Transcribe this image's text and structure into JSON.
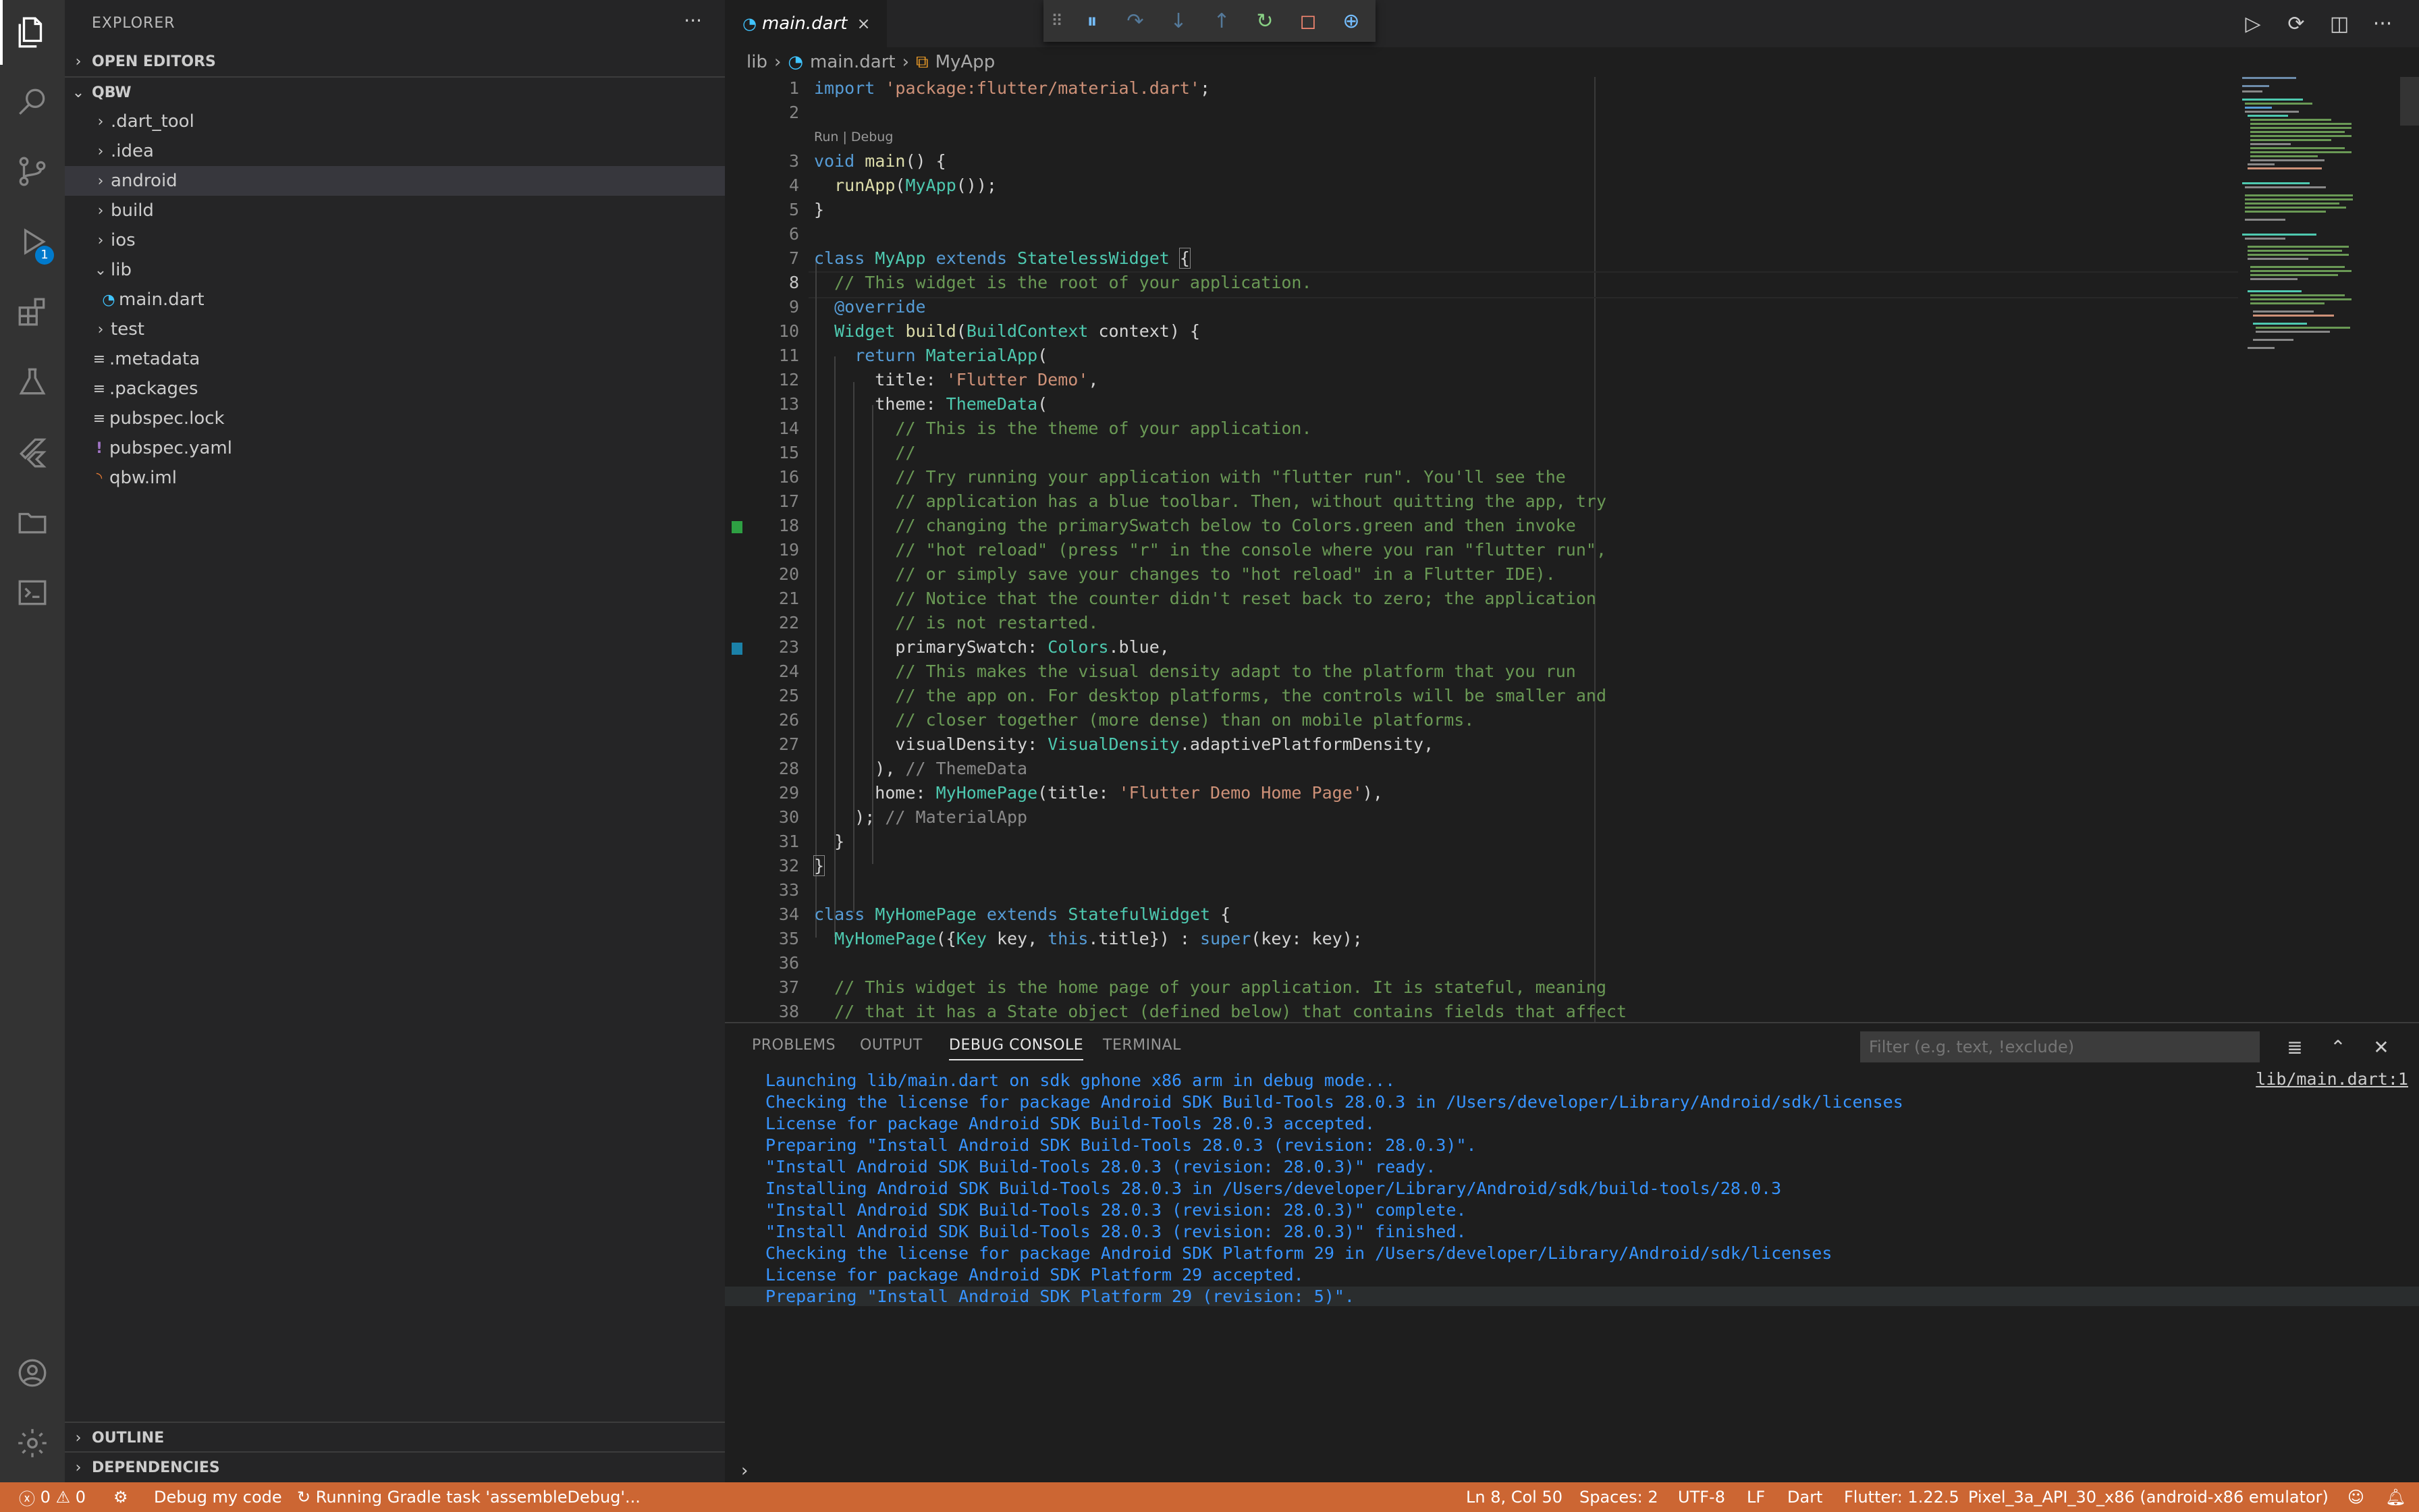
{
  "explorer": {
    "title": "EXPLORER",
    "more": "···",
    "open_editors": "OPEN EDITORS",
    "project": "QBW",
    "items": [
      {
        "label": ".dart_tool",
        "type": "folder"
      },
      {
        "label": ".idea",
        "type": "folder"
      },
      {
        "label": "android",
        "type": "folder"
      },
      {
        "label": "build",
        "type": "folder"
      },
      {
        "label": "ios",
        "type": "folder"
      },
      {
        "label": "lib",
        "type": "folder-open"
      },
      {
        "label": "main.dart",
        "type": "dart"
      },
      {
        "label": "test",
        "type": "folder"
      },
      {
        "label": ".metadata",
        "type": "text"
      },
      {
        "label": ".packages",
        "type": "text"
      },
      {
        "label": "pubspec.lock",
        "type": "text"
      },
      {
        "label": "pubspec.yaml",
        "type": "yaml"
      },
      {
        "label": "qbw.iml",
        "type": "rss"
      }
    ],
    "outline": "OUTLINE",
    "dependencies": "DEPENDENCIES"
  },
  "activity": {
    "debug_badge": "1",
    "icons": [
      "files-icon",
      "search-icon",
      "source-control-icon",
      "run-debug-icon",
      "extensions-icon",
      "testing-icon",
      "flutter-icon",
      "folder-icon",
      "terminal-icon"
    ]
  },
  "editor": {
    "tab_label": "main.dart",
    "tab_close": "×",
    "breadcrumb": {
      "folder": "lib",
      "file": "main.dart",
      "symbol": "MyApp"
    },
    "codelens": "Run | Debug",
    "cursor_line": 8
  },
  "panel": {
    "tabs": [
      "PROBLEMS",
      "OUTPUT",
      "DEBUG CONSOLE",
      "TERMINAL"
    ],
    "active_tab": "DEBUG CONSOLE",
    "filter_placeholder": "Filter (e.g. text, !exclude)",
    "source_link": "lib/main.dart:1",
    "console_lines": [
      "Launching lib/main.dart on sdk gphone x86 arm in debug mode...",
      "Checking the license for package Android SDK Build-Tools 28.0.3 in /Users/developer/Library/Android/sdk/licenses",
      "License for package Android SDK Build-Tools 28.0.3 accepted.",
      "Preparing \"Install Android SDK Build-Tools 28.0.3 (revision: 28.0.3)\".",
      "\"Install Android SDK Build-Tools 28.0.3 (revision: 28.0.3)\" ready.",
      "Installing Android SDK Build-Tools 28.0.3 in /Users/developer/Library/Android/sdk/build-tools/28.0.3",
      "\"Install Android SDK Build-Tools 28.0.3 (revision: 28.0.3)\" complete.",
      "\"Install Android SDK Build-Tools 28.0.3 (revision: 28.0.3)\" finished.",
      "Checking the license for package Android SDK Platform 29 in /Users/developer/Library/Android/sdk/licenses",
      "License for package Android SDK Platform 29 accepted.",
      "Preparing \"Install Android SDK Platform 29 (revision: 5)\"."
    ],
    "prompt": "›"
  },
  "statusbar": {
    "errors": "0",
    "warnings": "0",
    "debug_label": "Debug my code",
    "task": "Running Gradle task 'assembleDebug'...",
    "position": "Ln 8, Col 50",
    "spaces": "Spaces: 2",
    "encoding": "UTF-8",
    "eol": "LF",
    "language": "Dart",
    "flutter": "Flutter: 1.22.5",
    "device": "Pixel_3a_API_30_x86 (android-x86 emulator)",
    "background_color": "#cc6633"
  },
  "colors": {
    "keyword": "#569cd6",
    "type": "#4ec9b0",
    "string": "#ce9178",
    "comment": "#6a9955",
    "console_text": "#3794ff"
  }
}
